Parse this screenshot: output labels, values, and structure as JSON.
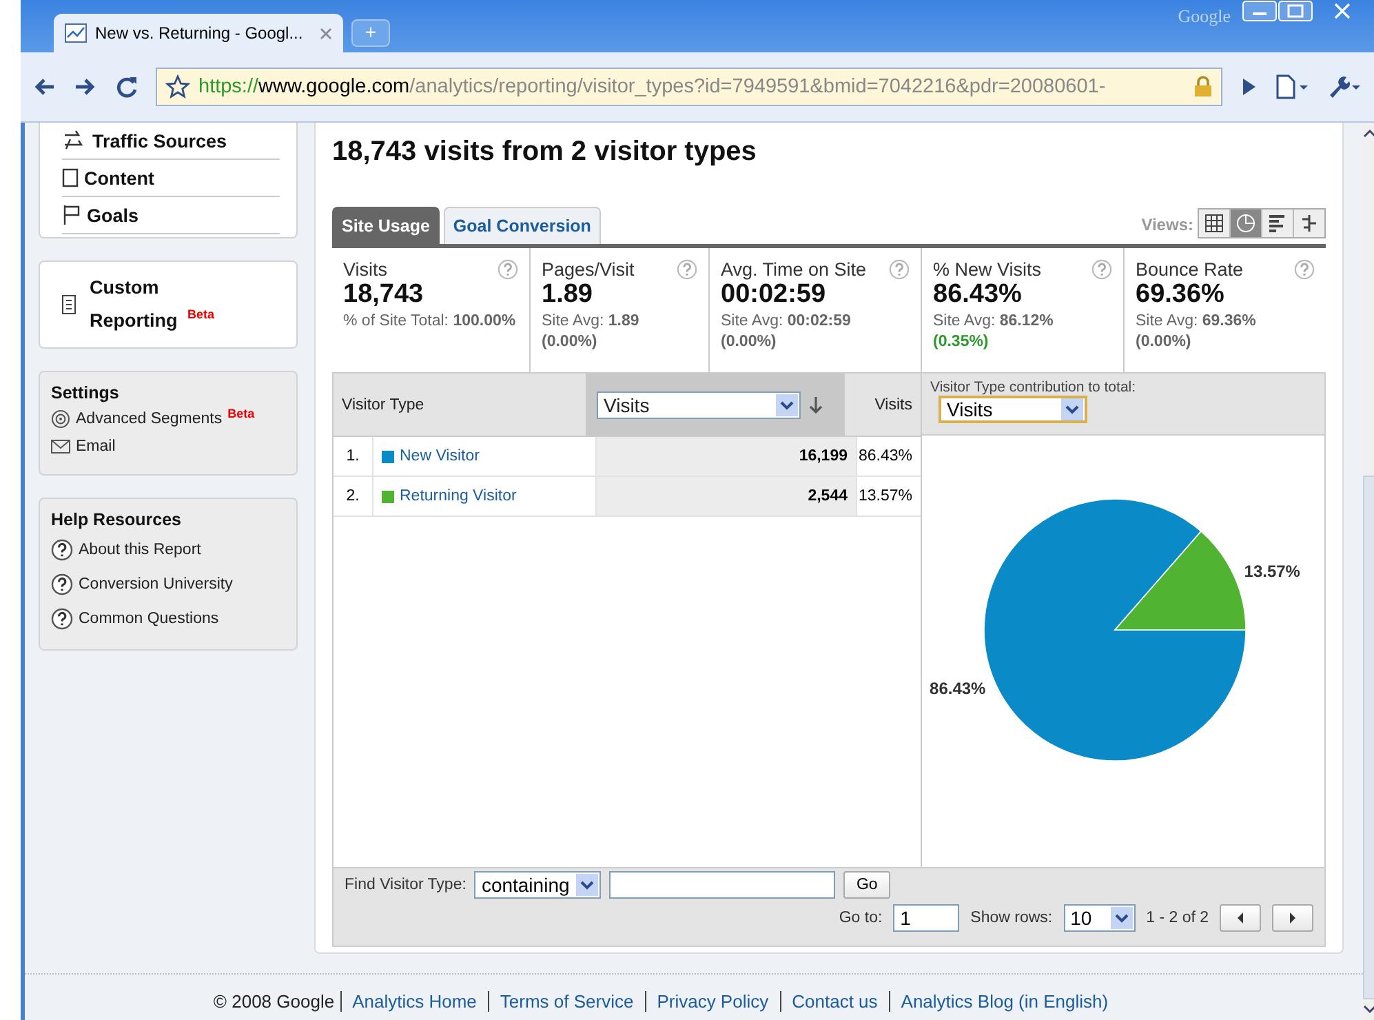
{
  "browser": {
    "brand": "Google",
    "tab_title": "New vs. Returning - Googl...",
    "new_tab": "+",
    "url": {
      "scheme": "https://",
      "host": "www.google.com",
      "path": "/analytics/reporting/visitor_types?id=7949591&bmid=7042216&pdr=20080601-"
    }
  },
  "sidebar": {
    "nav": [
      {
        "label": "Traffic Sources",
        "kind": "traffic"
      },
      {
        "label": "Content",
        "kind": "page"
      },
      {
        "label": "Goals",
        "kind": "flag"
      }
    ],
    "custom": {
      "label": "Custom Reporting",
      "badge": "Beta"
    },
    "settings": {
      "title": "Settings",
      "items": [
        {
          "label": "Advanced Segments",
          "kind": "segments",
          "badge": "Beta"
        },
        {
          "label": "Email",
          "kind": "email"
        }
      ]
    },
    "help": {
      "title": "Help Resources",
      "items": [
        {
          "label": "About this Report"
        },
        {
          "label": "Conversion University"
        },
        {
          "label": "Common Questions"
        }
      ]
    }
  },
  "report": {
    "title": "18,743 visits from 2 visitor types",
    "tabs": [
      {
        "label": "Site Usage",
        "selected": true
      },
      {
        "label": "Goal Conversion",
        "selected": false
      }
    ],
    "views_label": "Views:",
    "views": [
      {
        "kind": "table",
        "selected": false
      },
      {
        "kind": "pie",
        "selected": true
      },
      {
        "kind": "bars",
        "selected": false
      },
      {
        "kind": "compare",
        "selected": false
      }
    ],
    "scorecards": [
      {
        "label": "Visits",
        "value": "18,743",
        "sub_label": "% of Site Total:",
        "sub_value": "100.00%"
      },
      {
        "label": "Pages/Visit",
        "value": "1.89",
        "sub_label": "Site Avg:",
        "sub_value": "1.89",
        "delta": "(0.00%)",
        "kind": "neutral"
      },
      {
        "label": "Avg. Time on Site",
        "value": "00:02:59",
        "sub_label": "Site Avg:",
        "sub_value": "00:02:59",
        "delta": "(0.00%)",
        "kind": "neutral"
      },
      {
        "label": "% New Visits",
        "value": "86.43%",
        "sub_label": "Site Avg:",
        "sub_value": "86.12%",
        "delta": "(0.35%)",
        "kind": "positive"
      },
      {
        "label": "Bounce Rate",
        "value": "69.36%",
        "sub_label": "Site Avg:",
        "sub_value": "69.36%",
        "delta": "(0.00%)",
        "kind": "neutral"
      }
    ],
    "table": {
      "column_1": "Visitor Type",
      "metric_select": "Visits",
      "column_3": "Visits",
      "rows": [
        {
          "index": "1.",
          "name": "New Visitor",
          "color": "#0a8bc8",
          "visits": "16,199",
          "share": "86.43%"
        },
        {
          "index": "2.",
          "name": "Returning Visitor",
          "color": "#50b432",
          "visits": "2,544",
          "share": "13.57%"
        }
      ]
    },
    "contribution": {
      "label": "Visitor Type contribution to total:",
      "select": "Visits",
      "chart_data": {
        "type": "pie",
        "values": [
          86.43,
          13.57
        ],
        "value_labels": [
          "86.43%",
          "13.57%"
        ]
      }
    },
    "filter": {
      "label": "Find Visitor Type:",
      "select": "containing",
      "go": "Go",
      "goto_label": "Go to:",
      "goto_value": "1",
      "rows_label": "Show rows:",
      "rows_value": "10",
      "range": "1 - 2 of 2"
    }
  },
  "footer": {
    "copyright": "© 2008 Google",
    "links": [
      "Analytics Home",
      "Terms of Service",
      "Privacy Policy",
      "Contact us",
      "Analytics Blog (in English)"
    ]
  }
}
